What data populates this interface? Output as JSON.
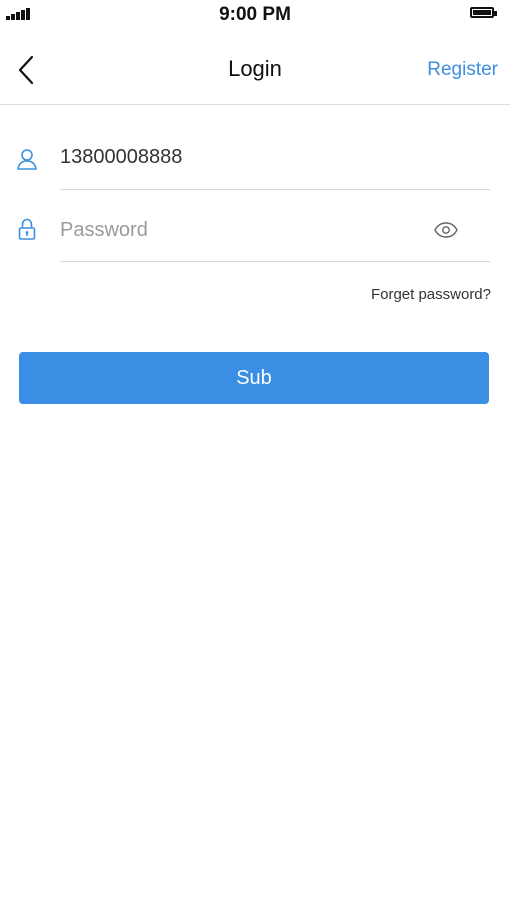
{
  "status_bar": {
    "time": "9:00 PM",
    "signal_icon": "signal-bars-icon",
    "battery_icon": "battery-full-icon"
  },
  "nav": {
    "back_icon": "chevron-left-icon",
    "title": "Login",
    "register_label": "Register"
  },
  "form": {
    "phone": {
      "icon": "user-icon",
      "value": "13800008888",
      "placeholder": ""
    },
    "password": {
      "icon": "lock-icon",
      "value": "",
      "placeholder": "Password",
      "toggle_icon": "eye-icon"
    },
    "forget_label": "Forget password?",
    "submit_label": "Sub"
  },
  "colors": {
    "accent": "#3a8ee4",
    "link": "#3d8fe0",
    "divider": "#d8d8d8",
    "text": "#333333",
    "placeholder": "#9a9a9a"
  }
}
